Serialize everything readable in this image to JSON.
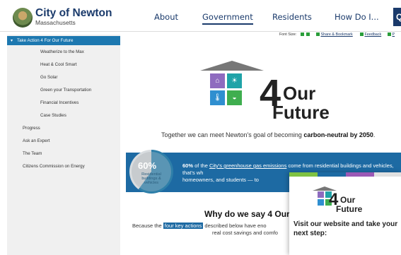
{
  "header": {
    "site_name": "City of Newton",
    "site_state": "Massachusetts",
    "nav": [
      {
        "label": "About"
      },
      {
        "label": "Government"
      },
      {
        "label": "Residents"
      },
      {
        "label": "How Do I..."
      }
    ],
    "nav_button_glyph": "Q"
  },
  "utility": {
    "font_size_label": "Font Size:",
    "share_label": "Share & Bookmark",
    "feedback_label": "Feedback",
    "print_label": "P"
  },
  "sidebar": {
    "active_item": "Take Action 4 For Our Future",
    "sub_items": [
      "Weatherize to the Max",
      "Heat & Cool Smart",
      "Go Solar",
      "Green your Transportation",
      "Financial Incentives",
      "Case Studies"
    ],
    "items": [
      "Progress",
      "Ask an Expert",
      "The Team",
      "Citizens Commission on Energy"
    ]
  },
  "hero": {
    "four": "4",
    "our": "Our",
    "future": "Future",
    "tagline_prefix": "Together we can meet Newton's goal of becoming ",
    "tagline_bold": "carbon-neutral by 2050",
    "tagline_suffix": "."
  },
  "stat": {
    "percent": "60%",
    "pie_label": "Residential buildings & vehicles",
    "pie_fraction": 0.6,
    "text_bold": "60%",
    "text_part1": " of the ",
    "text_link": "City's greenhouse gas emissions",
    "text_part2": " come from residential buildings and vehicles, that's wh",
    "text_part3": "homeowners, and students — to"
  },
  "why": {
    "heading": "Why do we say 4 Our",
    "because_prefix": "Because the ",
    "because_link": "four key actions",
    "because_suffix": " described below have eno",
    "because_line2": "real cost savings and comfo"
  },
  "popup": {
    "four": "4",
    "our": "Our",
    "future": "Future",
    "text": "Visit our website and take your next step:",
    "stripe_colors": [
      "#7fc242",
      "#1d6aa3",
      "#9b59b6",
      "#e0e0e0"
    ]
  },
  "colors": {
    "brand_navy": "#1a3a6b",
    "accent_blue": "#1d6aa3",
    "sidebar_active": "#1d78b0",
    "tile_purple": "#8e6bbf",
    "tile_teal": "#1fa3a8",
    "tile_blue": "#2f8fd0",
    "tile_green": "#3fae4f"
  },
  "icons": [
    "house-icon",
    "solar-panel-icon",
    "thermometer-icon",
    "car-icon",
    "search-icon",
    "share-icon",
    "feedback-icon",
    "print-icon"
  ]
}
